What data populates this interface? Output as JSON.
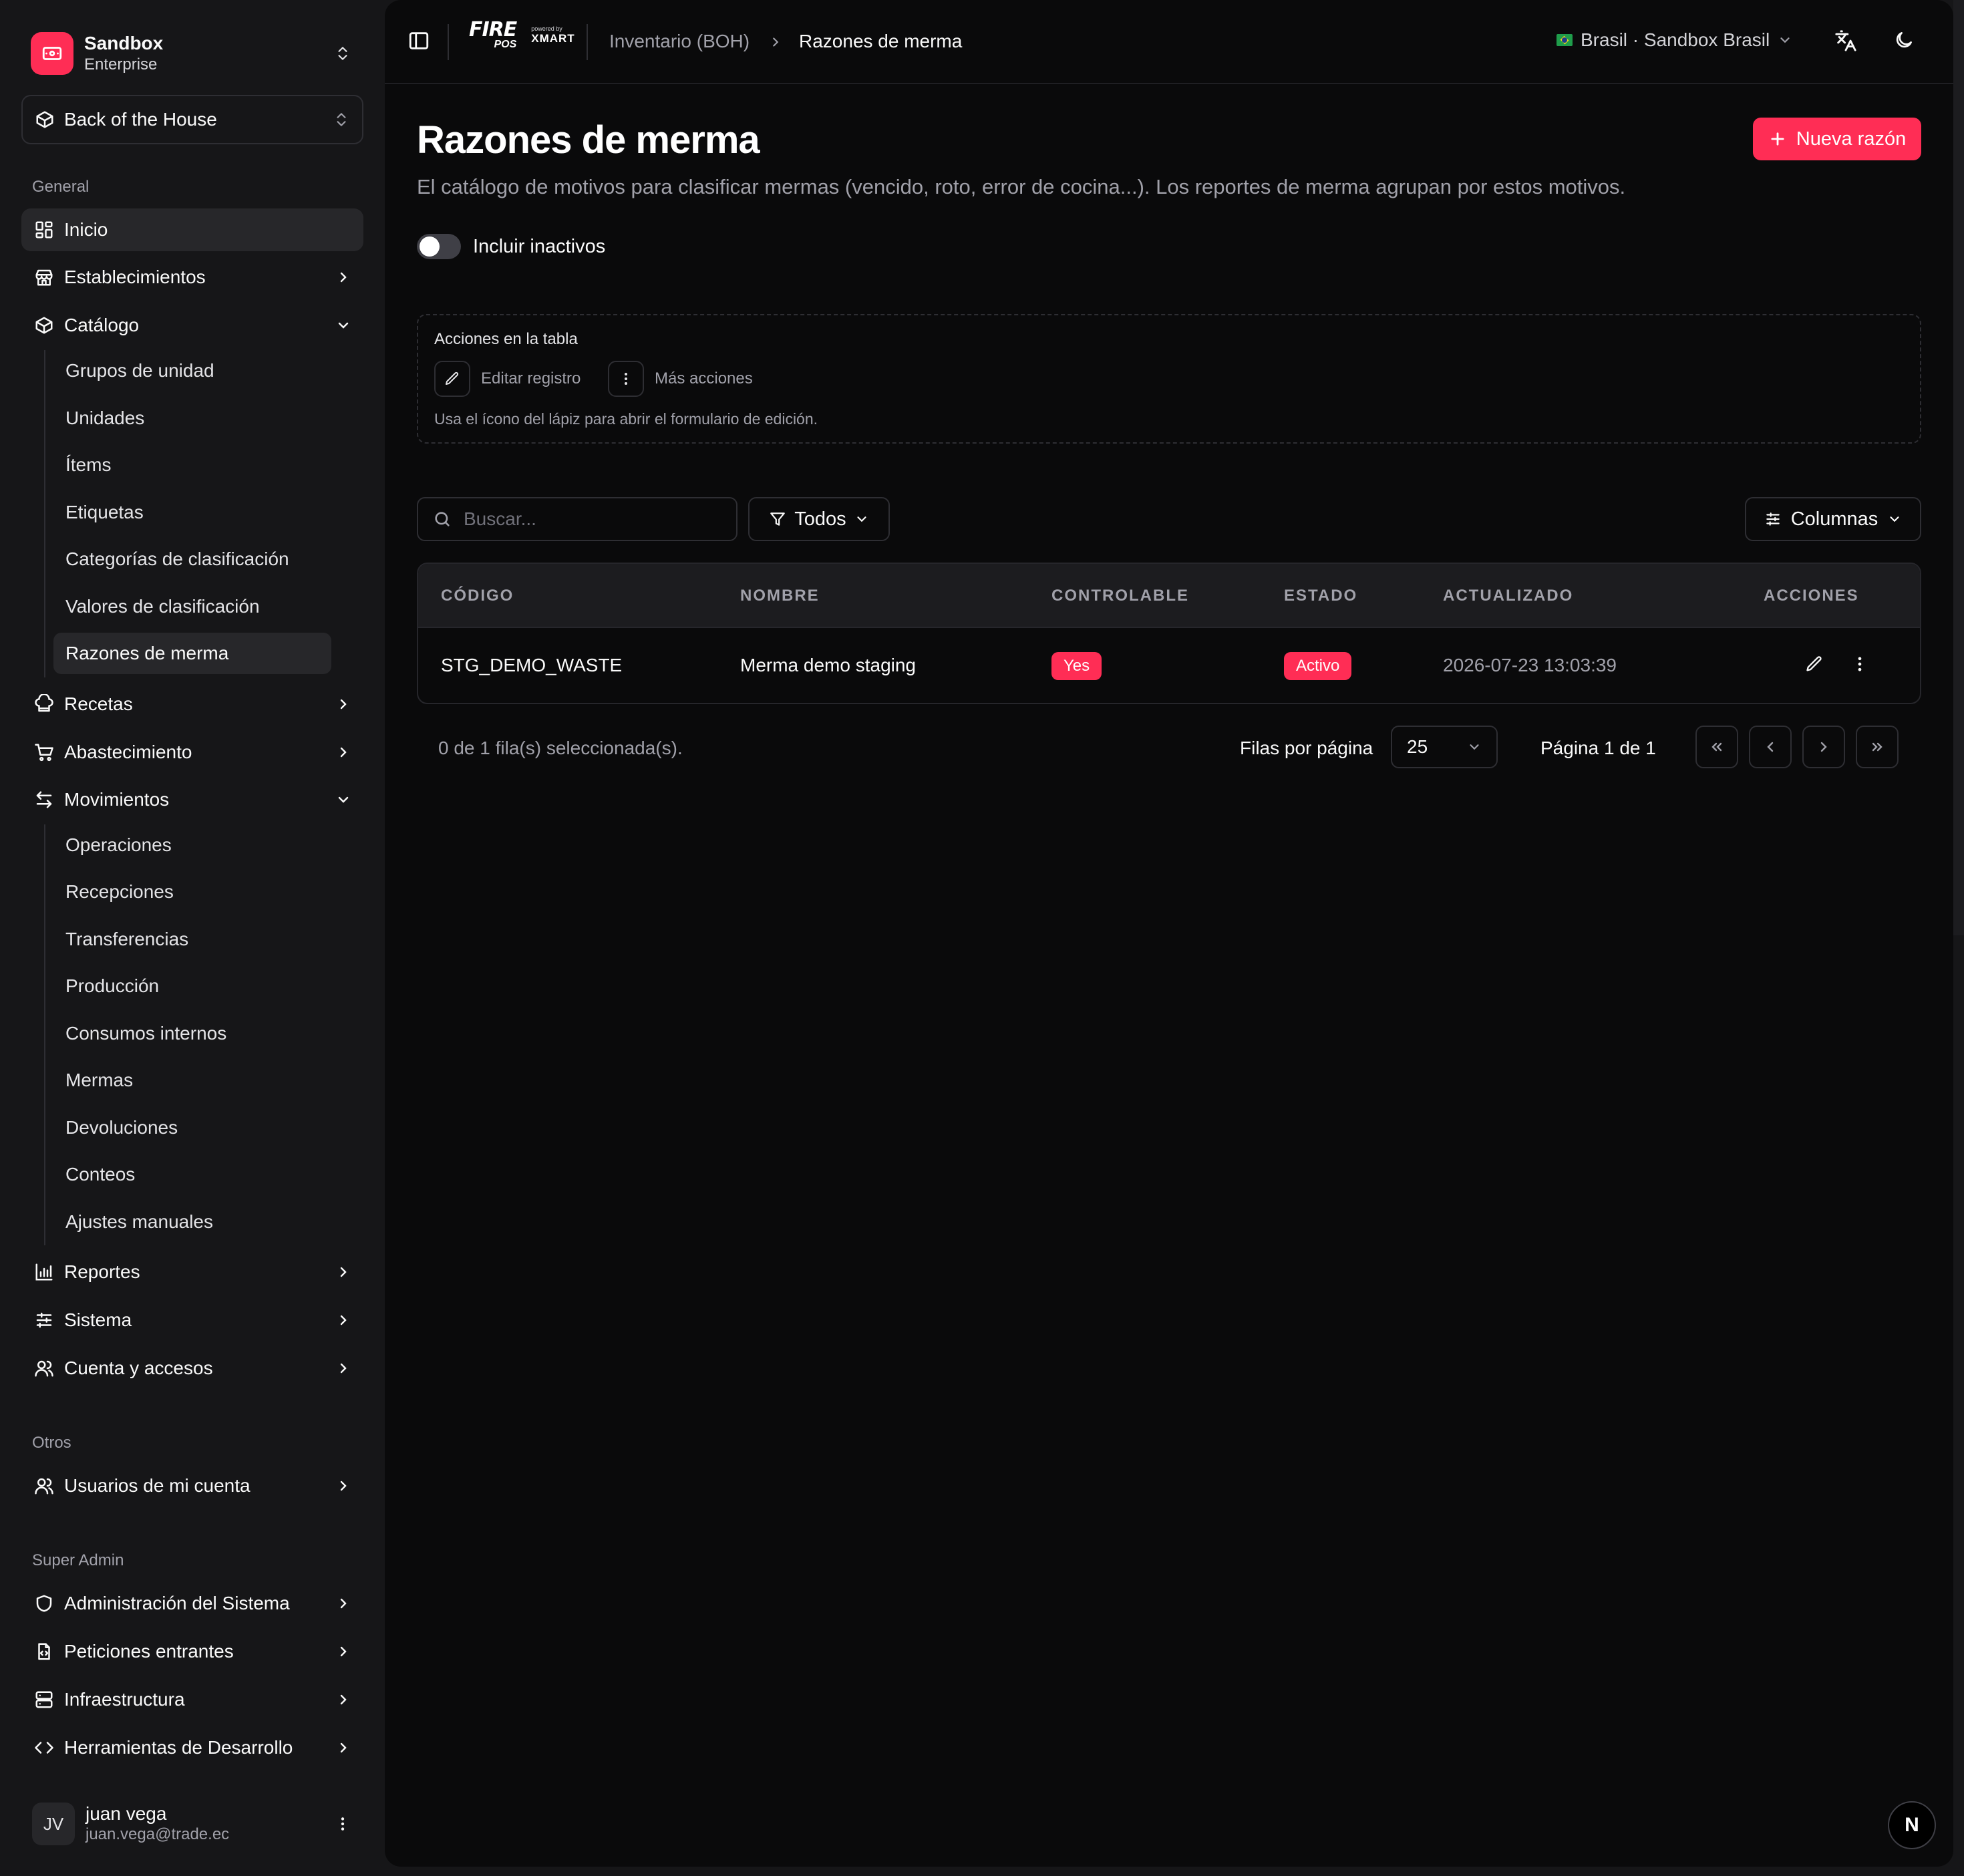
{
  "org": {
    "name": "Sandbox",
    "plan": "Enterprise"
  },
  "module": {
    "label": "Back of the House"
  },
  "sidebar": {
    "general_label": "General",
    "items": [
      {
        "label": "Inicio"
      },
      {
        "label": "Establecimientos"
      },
      {
        "label": "Catálogo"
      },
      {
        "label": "Recetas"
      },
      {
        "label": "Abastecimiento"
      },
      {
        "label": "Movimientos"
      },
      {
        "label": "Reportes"
      },
      {
        "label": "Sistema"
      },
      {
        "label": "Cuenta y accesos"
      }
    ],
    "catalogo_sub": [
      "Grupos de unidad",
      "Unidades",
      "Ítems",
      "Etiquetas",
      "Categorías de clasificación",
      "Valores de clasificación",
      "Razones de merma"
    ],
    "movimientos_sub": [
      "Operaciones",
      "Recepciones",
      "Transferencias",
      "Producción",
      "Consumos internos",
      "Mermas",
      "Devoluciones",
      "Conteos",
      "Ajustes manuales"
    ],
    "otros_label": "Otros",
    "otros_items": [
      {
        "label": "Usuarios de mi cuenta"
      }
    ],
    "superadmin_label": "Super Admin",
    "superadmin_items": [
      {
        "label": "Administración del Sistema"
      },
      {
        "label": "Peticiones entrantes"
      },
      {
        "label": "Infraestructura"
      },
      {
        "label": "Herramientas de Desarrollo"
      }
    ]
  },
  "user": {
    "initials": "JV",
    "name": "juan vega",
    "email": "juan.vega@trade.ec"
  },
  "topbar": {
    "brand_fire": "FIRE",
    "brand_pos": "POS",
    "brand_powered": "powered by",
    "brand_xmart": "XMART",
    "breadcrumb": [
      "Inventario (BOH)",
      "Razones de merma"
    ],
    "tenant": "Brasil · Sandbox Brasil"
  },
  "page": {
    "title": "Razones de merma",
    "description": "El catálogo de motivos para clasificar mermas (vencido, roto, error de cocina...). Los reportes de merma agrupan por estos motivos.",
    "new_button": "Nueva razón",
    "toggle_label": "Incluir inactivos"
  },
  "hint": {
    "title": "Acciones en la tabla",
    "edit": "Editar registro",
    "more": "Más acciones",
    "note": "Usa el ícono del lápiz para abrir el formulario de edición."
  },
  "toolbar": {
    "search_placeholder": "Buscar...",
    "filter_label": "Todos",
    "columns_label": "Columnas"
  },
  "table": {
    "headers": [
      "CÓDIGO",
      "NOMBRE",
      "CONTROLABLE",
      "ESTADO",
      "ACTUALIZADO",
      "ACCIONES"
    ],
    "rows": [
      {
        "code": "STG_DEMO_WASTE",
        "name": "Merma demo staging",
        "controllable": "Yes",
        "status": "Activo",
        "updated": "2026-07-23 13:03:39"
      }
    ]
  },
  "pagination": {
    "selected": "0 de 1 fila(s) seleccionada(s).",
    "rows_label": "Filas por página",
    "rows_value": "25",
    "page_label": "Página 1 de 1"
  },
  "colors": {
    "accent": "#ff2d55",
    "background": "#0a0a0b",
    "sidebar": "#161618"
  },
  "misc": {
    "dev_badge": "N"
  }
}
